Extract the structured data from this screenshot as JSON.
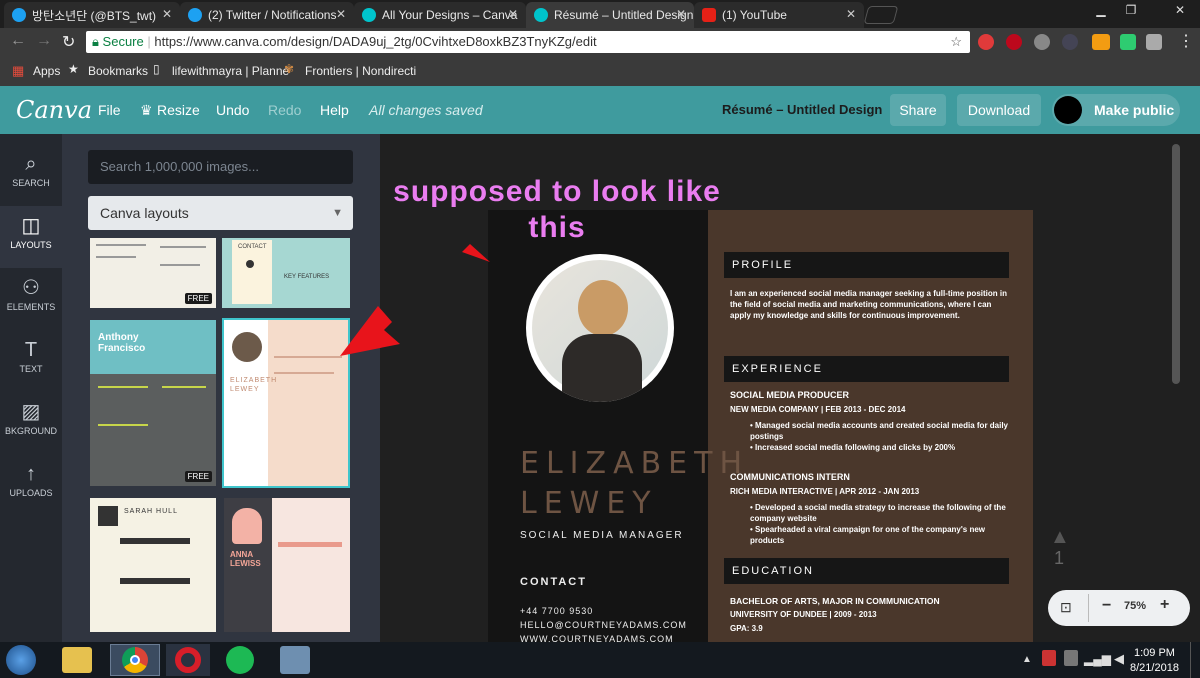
{
  "tabs": [
    {
      "title": "방탄소년단 (@BTS_twt)",
      "icon": "twitter-icon"
    },
    {
      "title": "(2) Twitter / Notifications",
      "icon": "twitter-icon"
    },
    {
      "title": "All Your Designs – Canva",
      "icon": "canva-icon"
    },
    {
      "title": "Résumé – Untitled Design",
      "icon": "canva-icon"
    },
    {
      "title": "(1) YouTube",
      "icon": "youtube-icon"
    }
  ],
  "address": {
    "secure": "Secure",
    "url": "https://www.canva.com/design/DADA9uj_2tg/0CvihtxeD8oxkBZ3TnyKZg/edit"
  },
  "bookmarks": {
    "apps": "Apps",
    "bookmarks": "Bookmarks",
    "b1": "lifewithmayra | Planne",
    "b2": "Frontiers | Nondirecti"
  },
  "header": {
    "logo": "Canva",
    "file": "File",
    "resize": "Resize",
    "undo": "Undo",
    "redo": "Redo",
    "help": "Help",
    "saved": "All changes saved",
    "doc_title": "Résumé – Untitled Design",
    "share": "Share",
    "download": "Download",
    "make_public": "Make public"
  },
  "sidebar": [
    {
      "label": "SEARCH",
      "icon": "search-icon"
    },
    {
      "label": "LAYOUTS",
      "icon": "layouts-icon"
    },
    {
      "label": "ELEMENTS",
      "icon": "elements-icon"
    },
    {
      "label": "TEXT",
      "icon": "text-icon"
    },
    {
      "label": "BKGROUND",
      "icon": "background-icon"
    },
    {
      "label": "UPLOADS",
      "icon": "uploads-icon"
    }
  ],
  "panel": {
    "search_placeholder": "Search 1,000,000 images...",
    "dropdown": "Canva layouts",
    "free": "FREE",
    "t_anthony": "Anthony Francisco",
    "t_sarah": "SARAH HULL",
    "t_anna": "ANNA LEWISS",
    "t_contact": "CONTACT",
    "t_keyfeat": "KEY FEATURES",
    "t_elizabeth": "ELIZABETH LEWEY"
  },
  "annotation": "supposed to look like this",
  "resume": {
    "first": "ELIZABETH",
    "last": "LEWEY",
    "role": "SOCIAL MEDIA MANAGER",
    "contact_h": "CONTACT",
    "phone": "+44 7700 9530",
    "email": "HELLO@COURTNEYADAMS.COM",
    "web": "WWW.COURTNEYADAMS.COM",
    "profile_h": "PROFILE",
    "profile": "I am an experienced social media manager seeking a full-time position in the field of social media and marketing communications, where I can apply my knowledge and skills for continuous improvement.",
    "exp_h": "EXPERIENCE",
    "job1_t": "SOCIAL MEDIA PRODUCER",
    "job1_c": "NEW MEDIA COMPANY  |  FEB 2013 - DEC 2014",
    "job1_b1": "Managed social media accounts and created social media for daily postings",
    "job1_b2": "Increased social media following and clicks by 200%",
    "job2_t": "COMMUNICATIONS INTERN",
    "job2_c": "RICH MEDIA INTERACTIVE  |  APR 2012 - JAN 2013",
    "job2_b1": "Developed a social media strategy to increase the following of the company website",
    "job2_b2": "Spearheaded a viral campaign for one of the company's new products",
    "edu_h": "EDUCATION",
    "edu_t": "BACHELOR OF ARTS, MAJOR IN COMMUNICATION",
    "edu_s": "UNIVERSITY OF DUNDEE  |  2009 - 2013",
    "gpa": "GPA: 3.9"
  },
  "page_number": "1",
  "zoom": "75%",
  "taskbar": {
    "time": "1:09 PM",
    "date": "8/21/2018"
  }
}
